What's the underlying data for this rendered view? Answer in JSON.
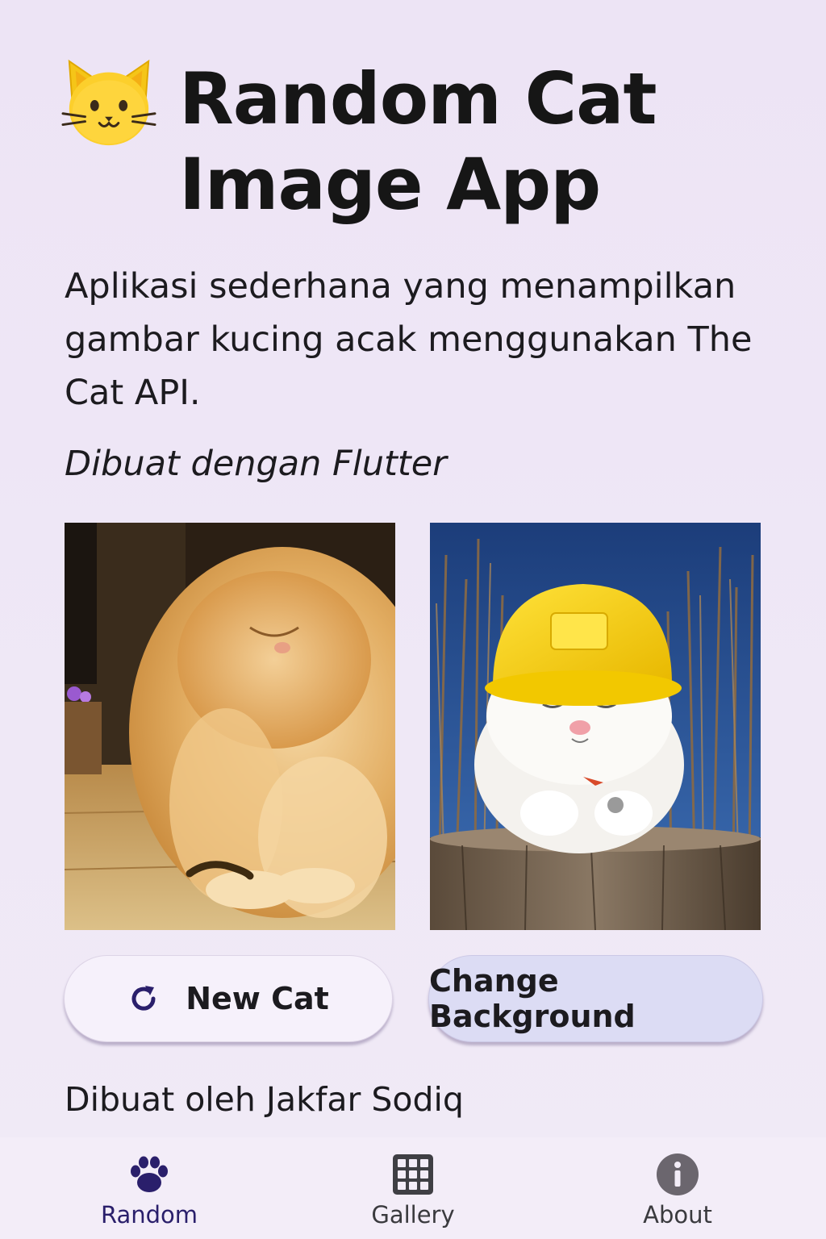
{
  "header": {
    "emoji": "🐱",
    "title": "Random Cat Image App"
  },
  "description": "Aplikasi sederhana yang menampilkan gambar kucing acak menggunakan The Cat API.",
  "subtitle": "Dibuat dengan Flutter",
  "images": [
    {
      "name": "fluffy-orange-cat-photo"
    },
    {
      "name": "white-cat-yellow-hardhat-photo"
    }
  ],
  "buttons": {
    "new_cat": {
      "label": "New Cat",
      "icon": "refresh-icon"
    },
    "change_background": {
      "label": "Change Background"
    }
  },
  "footer": {
    "credit": "Dibuat oleh Jakfar Sodiq"
  },
  "bottom_nav": {
    "active": "random",
    "items": [
      {
        "id": "random",
        "label": "Random",
        "icon": "paw-icon"
      },
      {
        "id": "gallery",
        "label": "Gallery",
        "icon": "grid-icon"
      },
      {
        "id": "about",
        "label": "About",
        "icon": "info-icon"
      }
    ]
  },
  "colors": {
    "background": "#efe7f6",
    "accent": "#2a1f6b",
    "new_cat_button": "#f6f1fb",
    "change_background_button": "#dcdcf4"
  }
}
